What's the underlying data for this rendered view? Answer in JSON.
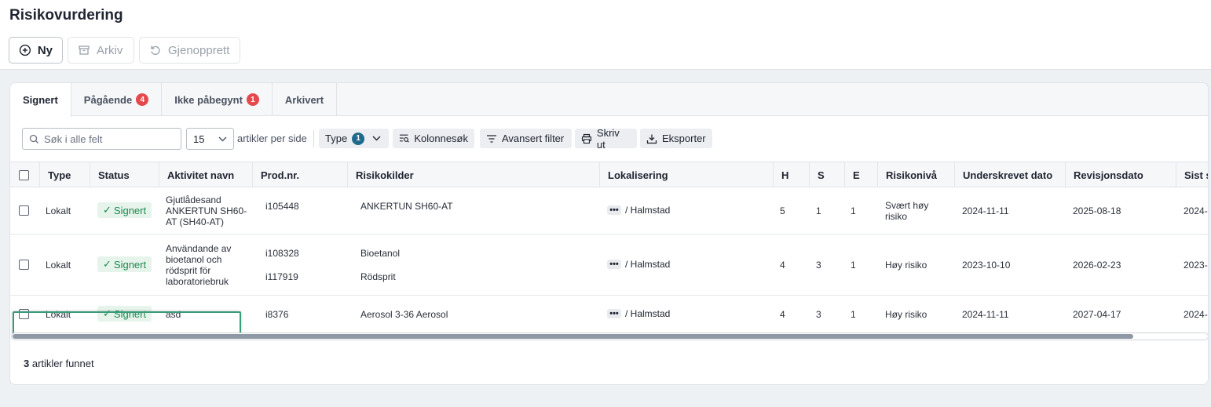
{
  "page": {
    "title": "Risikovurdering"
  },
  "toolbar": {
    "new_label": "Ny",
    "archive_label": "Arkiv",
    "restore_label": "Gjenopprett"
  },
  "tabs": [
    {
      "label": "Signert",
      "badge": ""
    },
    {
      "label": "Pågående",
      "badge": "4"
    },
    {
      "label": "Ikke påbegynt",
      "badge": "1"
    },
    {
      "label": "Arkivert",
      "badge": ""
    }
  ],
  "filters": {
    "search_placeholder": "Søk i alle felt",
    "per_page_value": "15",
    "per_page_label": "artikler per side",
    "type_label": "Type",
    "type_badge": "1",
    "column_search_label": "Kolonnesøk",
    "advanced_filter_label": "Avansert filter",
    "print_label": "Skriv ut",
    "export_label": "Eksporter"
  },
  "table": {
    "columns": [
      "Type",
      "Status",
      "Aktivitet navn",
      "Prod.nr.",
      "Risikokilder",
      "Lokalisering",
      "H",
      "S",
      "E",
      "Risikonivå",
      "Underskrevet dato",
      "Revisjonsdato",
      "Sist s"
    ],
    "rows": [
      {
        "type": "Lokalt",
        "status": "Signert",
        "activity": [
          "Gjutlådesand",
          "ANKERTUN SH60-",
          "AT (SH40-AT)"
        ],
        "prod": [
          "i105448"
        ],
        "sources": [
          "ANKERTUN SH60-AT"
        ],
        "location": "/ Halmstad",
        "h": "5",
        "s": "1",
        "e": "1",
        "risk": [
          "Svært høy",
          "risiko"
        ],
        "signed": "2024-11-11",
        "revision": "2025-08-18",
        "last": "2024-"
      },
      {
        "type": "Lokalt",
        "status": "Signert",
        "activity": [
          "Användande av",
          "bioetanol och",
          "rödsprit för",
          "laboratoriebruk"
        ],
        "prod": [
          "i108328",
          "i117919"
        ],
        "sources": [
          "Bioetanol",
          "Rödsprit"
        ],
        "location": "/ Halmstad",
        "h": "4",
        "s": "3",
        "e": "1",
        "risk": [
          "Høy risiko"
        ],
        "signed": "2023-10-10",
        "revision": "2026-02-23",
        "last": "2023-"
      },
      {
        "type": "Lokalt",
        "status": "Signert",
        "activity": [
          "asd"
        ],
        "prod": [
          "i8376"
        ],
        "sources": [
          "Aerosol 3-36 Aerosol"
        ],
        "location": "/ Halmstad",
        "h": "4",
        "s": "3",
        "e": "1",
        "risk": [
          "Høy risiko"
        ],
        "signed": "2024-11-11",
        "revision": "2027-04-17",
        "last": "2024-"
      }
    ]
  },
  "footer": {
    "count": "3",
    "count_label": " artikler funnet"
  },
  "colors": {
    "accent_highlight": "#3a9b7a",
    "badge_red": "#e5484d",
    "type_badge": "#1e6a8d",
    "status_green": "#1d8a4e"
  }
}
